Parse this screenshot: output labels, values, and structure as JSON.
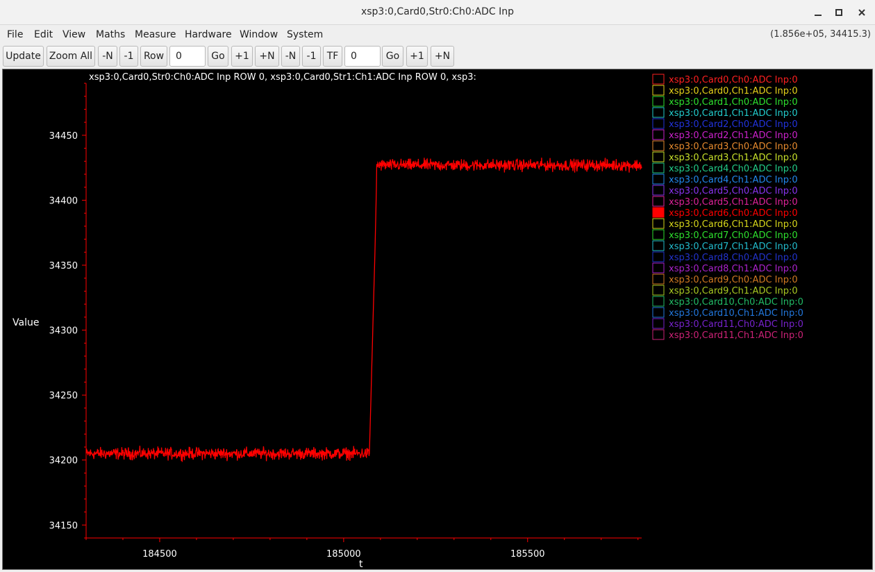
{
  "window": {
    "title": "xsp3:0,Card0,Str0:Ch0:ADC Inp",
    "minimize_icon": "minimize-icon",
    "maximize_icon": "maximize-icon",
    "close_icon": "close-icon"
  },
  "menu": [
    "File",
    "Edit",
    "View",
    "Maths",
    "Measure",
    "Hardware",
    "Window",
    "System"
  ],
  "coords": "(1.856e+05,  34415.3)",
  "toolbar": {
    "update": "Update",
    "zoom_all": "Zoom All",
    "minus_n": "-N",
    "minus_1": "-1",
    "row": "Row",
    "row_value": "0",
    "go": "Go",
    "plus_1": "+1",
    "plus_n": "+N",
    "minus_n2": "-N",
    "minus_12": "-1",
    "tf": "TF",
    "tf_value": "0",
    "go2": "Go",
    "plus_12": "+1",
    "plus_n2": "+N"
  },
  "plot": {
    "header": "xsp3:0,Card0,Str0:Ch0:ADC Inp ROW 0, xsp3:0,Card0,Str1:Ch1:ADC Inp ROW 0, xsp3:",
    "legend": [
      {
        "label": "xsp3:0,Card0,Ch0:ADC Inp:0",
        "color": "#ff2020",
        "selected": false
      },
      {
        "label": "xsp3:0,Card0,Ch1:ADC Inp:0",
        "color": "#e6d21a",
        "selected": false
      },
      {
        "label": "xsp3:0,Card1,Ch0:ADC Inp:0",
        "color": "#2ee02e",
        "selected": false
      },
      {
        "label": "xsp3:0,Card1,Ch1:ADC Inp:0",
        "color": "#22cccc",
        "selected": false
      },
      {
        "label": "xsp3:0,Card2,Ch0:ADC Inp:0",
        "color": "#2233dd",
        "selected": false
      },
      {
        "label": "xsp3:0,Card2,Ch1:ADC Inp:0",
        "color": "#cc22cc",
        "selected": false
      },
      {
        "label": "xsp3:0,Card3,Ch0:ADC Inp:0",
        "color": "#e68a2e",
        "selected": false
      },
      {
        "label": "xsp3:0,Card3,Ch1:ADC Inp:0",
        "color": "#c8e02a",
        "selected": false
      },
      {
        "label": "xsp3:0,Card4,Ch0:ADC Inp:0",
        "color": "#22cc88",
        "selected": false
      },
      {
        "label": "xsp3:0,Card4,Ch1:ADC Inp:0",
        "color": "#2288ee",
        "selected": false
      },
      {
        "label": "xsp3:0,Card5,Ch0:ADC Inp:0",
        "color": "#8833ee",
        "selected": false
      },
      {
        "label": "xsp3:0,Card5,Ch1:ADC Inp:0",
        "color": "#dd2299",
        "selected": false
      },
      {
        "label": "xsp3:0,Card6,Ch0:ADC Inp:0",
        "color": "#ff0000",
        "selected": true
      },
      {
        "label": "xsp3:0,Card6,Ch1:ADC Inp:0",
        "color": "#d6d61a",
        "selected": false
      },
      {
        "label": "xsp3:0,Card7,Ch0:ADC Inp:0",
        "color": "#2ee02e",
        "selected": false
      },
      {
        "label": "xsp3:0,Card7,Ch1:ADC Inp:0",
        "color": "#22bbcc",
        "selected": false
      },
      {
        "label": "xsp3:0,Card8,Ch0:ADC Inp:0",
        "color": "#2233cc",
        "selected": false
      },
      {
        "label": "xsp3:0,Card8,Ch1:ADC Inp:0",
        "color": "#aa22cc",
        "selected": false
      },
      {
        "label": "xsp3:0,Card9,Ch0:ADC Inp:0",
        "color": "#d27a22",
        "selected": false
      },
      {
        "label": "xsp3:0,Card9,Ch1:ADC Inp:0",
        "color": "#a8c822",
        "selected": false
      },
      {
        "label": "xsp3:0,Card10,Ch0:ADC Inp:0",
        "color": "#22bb66",
        "selected": false
      },
      {
        "label": "xsp3:0,Card10,Ch1:ADC Inp:0",
        "color": "#2277dd",
        "selected": false
      },
      {
        "label": "xsp3:0,Card11,Ch0:ADC Inp:0",
        "color": "#7722cc",
        "selected": false
      },
      {
        "label": "xsp3:0,Card11,Ch1:ADC Inp:0",
        "color": "#cc2277",
        "selected": false
      }
    ],
    "axis_color": "#ff0000",
    "label_color": "#ffffff"
  },
  "chart_data": {
    "type": "line",
    "xlabel": "t",
    "ylabel": "Value",
    "xlim": [
      184300,
      185810
    ],
    "ylim": [
      34140,
      34490
    ],
    "x_ticks": [
      184500,
      185000,
      185500
    ],
    "y_ticks": [
      34150,
      34200,
      34250,
      34300,
      34350,
      34400,
      34450
    ],
    "series": [
      {
        "name": "xsp3:0,Card0,Ch0:ADC Inp:0",
        "color": "#ff0000",
        "segments": [
          {
            "x0": 184300,
            "x1": 185070,
            "level": 34205,
            "noise": 3
          },
          {
            "x0": 185070,
            "x1": 185085,
            "from": 34205,
            "to": 34360
          },
          {
            "x0": 185085,
            "x1": 185090,
            "from": 34360,
            "to": 34422
          },
          {
            "x0": 185090,
            "x1": 185810,
            "level": 34427,
            "noise": 3
          }
        ]
      }
    ]
  }
}
